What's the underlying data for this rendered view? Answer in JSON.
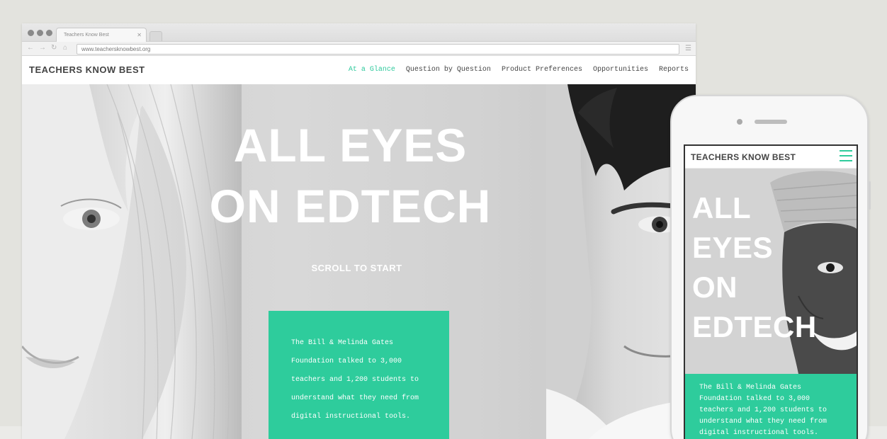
{
  "browser": {
    "tab_title": "Teachers Know Best",
    "url": "www.teachersknowbest.org"
  },
  "site": {
    "logo": "TEACHERS KNOW BEST",
    "nav": [
      {
        "label": "At a Glance",
        "active": true
      },
      {
        "label": "Question by Question",
        "active": false
      },
      {
        "label": "Product Preferences",
        "active": false
      },
      {
        "label": "Opportunities",
        "active": false
      },
      {
        "label": "Reports",
        "active": false
      }
    ],
    "hero_line1": "ALL EYES",
    "hero_line2": "ON EDTECH",
    "scroll_cta": "SCROLL TO START",
    "intro_text": "The Bill & Melinda Gates Foundation talked to 3,000 teachers and 1,200 students to understand what they need from digital instructional tools."
  },
  "mobile": {
    "logo": "TEACHERS KNOW BEST",
    "hero_lines": [
      "ALL",
      "EYES",
      "ON",
      "EDTECH"
    ],
    "intro_text": "The Bill & Melinda Gates Foundation talked to 3,000 teachers and 1,200 students to understand what they need from digital instructional tools."
  },
  "colors": {
    "accent": "#2ecc9c",
    "text_dark": "#444444",
    "hero_bg": "#d4d4d4"
  },
  "icons": [
    "back-arrow-icon",
    "forward-arrow-icon",
    "reload-icon",
    "home-icon",
    "menu-icon",
    "hamburger-menu-icon"
  ]
}
